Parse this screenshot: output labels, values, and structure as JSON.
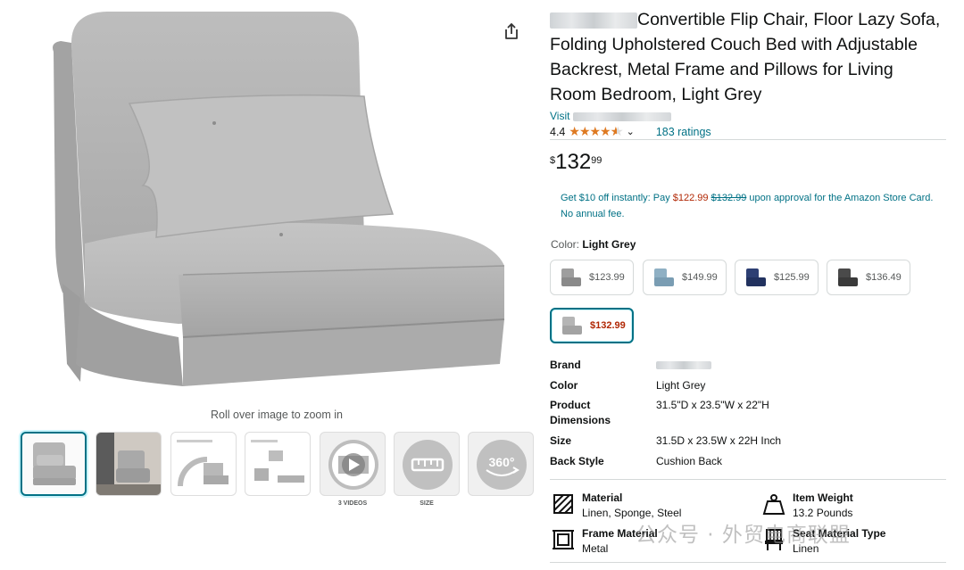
{
  "product": {
    "title_rest": "Convertible Flip Chair, Floor Lazy Sofa, Folding Upholstered Couch Bed with Adjustable Backrest, Metal Frame and Pillows for Living Room Bedroom, Light Grey",
    "visit_prefix": "Visit",
    "rating_value": "4.4",
    "rating_stars": 4.4,
    "ratings_count": "183 ratings",
    "price_symbol": "$",
    "price_whole": "132",
    "price_fraction": "99"
  },
  "promo": {
    "text_before": "Get $10 off instantly: Pay ",
    "new_price": "$122.99",
    "old_price": "$132.99",
    "text_after": " upon approval for the Amazon Store Card. No annual fee."
  },
  "gallery": {
    "zoom_hint": "Roll over image to zoom in",
    "videos_caption": "3 VIDEOS",
    "size_caption": "SIZE"
  },
  "color": {
    "label": "Color:",
    "selected": "Light Grey",
    "options": [
      {
        "price": "$123.99",
        "color": "#9e9e9e"
      },
      {
        "price": "$149.99",
        "color": "#8fb0c4"
      },
      {
        "price": "$125.99",
        "color": "#2d3f73"
      },
      {
        "price": "$136.49",
        "color": "#4a4a4a"
      },
      {
        "price": "$132.99",
        "color": "#b5b5b5"
      }
    ]
  },
  "specs": [
    {
      "key": "Brand",
      "value": ""
    },
    {
      "key": "Color",
      "value": "Light Grey"
    },
    {
      "key": "Product Dimensions",
      "value": "31.5\"D x 23.5\"W x 22\"H"
    },
    {
      "key": "Size",
      "value": "31.5D x 23.5W x 22H Inch"
    },
    {
      "key": "Back Style",
      "value": "Cushion Back"
    }
  ],
  "features": [
    {
      "key": "Material",
      "value": "Linen, Sponge, Steel",
      "icon": "material-icon"
    },
    {
      "key": "Item Weight",
      "value": "13.2 Pounds",
      "icon": "weight-icon"
    },
    {
      "key": "Frame Material",
      "value": "Metal",
      "icon": "frame-icon"
    },
    {
      "key": "Seat Material Type",
      "value": "Linen",
      "icon": "seat-icon"
    }
  ],
  "watermark": "公众号 · 外贸电商联盟",
  "colors": {
    "link": "#007185",
    "price_red": "#b12704",
    "star": "#de7921"
  }
}
